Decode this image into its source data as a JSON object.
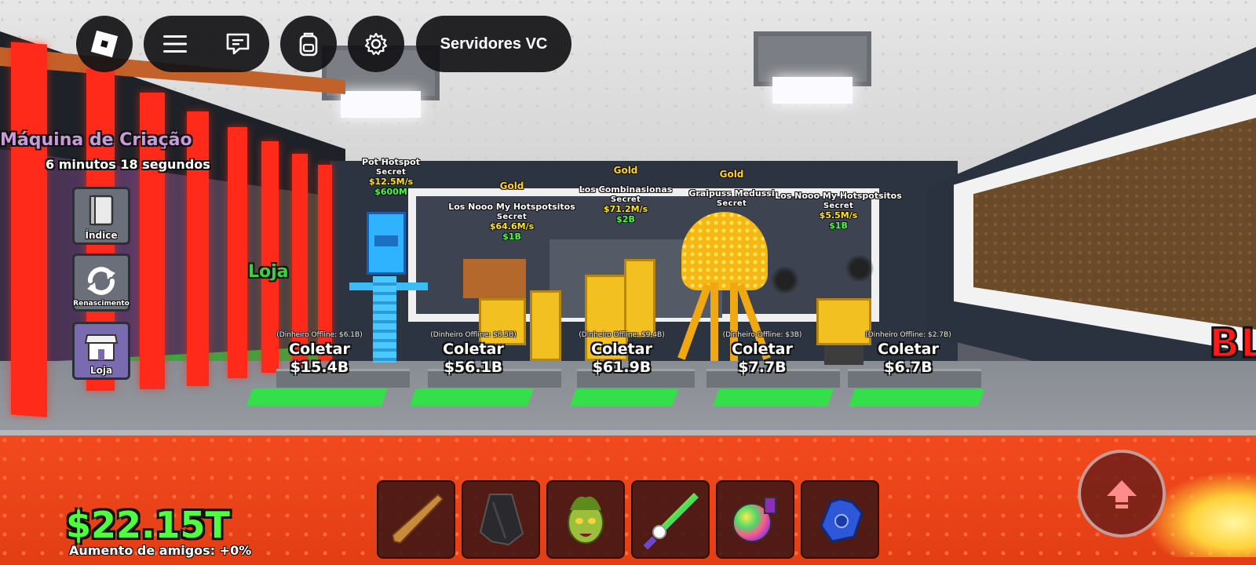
{
  "top_bar": {
    "roblox_menu_icon": "roblox-logo-icon",
    "hamburger_icon": "hamburger-menu-icon",
    "chat_icon": "chat-icon",
    "backpack_icon": "backpack-icon",
    "settings_icon": "gear-icon",
    "servers_label": "Servidores VC"
  },
  "world": {
    "machine_title": "Máquina de Criação",
    "machine_timer": "6 minutos 18 segundos",
    "shop_sign": "Loja",
    "edge_text": "BL"
  },
  "side_buttons": {
    "index_label": "Índice",
    "rebirth_label": "Renascimento",
    "shop_label": "Loja"
  },
  "brainrots": [
    {
      "mutation": "",
      "name": "Pot Hotspot",
      "rarity": "Secret",
      "rate": "$12.5M/s",
      "price": "$600M"
    },
    {
      "mutation": "Gold",
      "name": "Los Nooo My Hotspotsitos",
      "rarity": "Secret",
      "rate": "$64.6M/s",
      "price": "$1B"
    },
    {
      "mutation": "Gold",
      "name": "Los Combinasionas",
      "rarity": "Secret",
      "rate": "$71.2M/s",
      "price": "$2B"
    },
    {
      "mutation": "Gold",
      "name": "Graipuss Medussi",
      "rarity": "Secret",
      "rate": "",
      "price": ""
    },
    {
      "mutation": "",
      "name": "Los Nooo My Hotspotsitos",
      "rarity": "Secret",
      "rate": "$5.5M/s",
      "price": "$1B"
    }
  ],
  "collectors": [
    {
      "offline": "(Dinheiro Offline: $6.1B)",
      "button": "Coletar",
      "amount": "$15.4B"
    },
    {
      "offline": "(Dinheiro Offline: $8.5B)",
      "button": "Coletar",
      "amount": "$56.1B"
    },
    {
      "offline": "(Dinheiro Offline: $9.4B)",
      "button": "Coletar",
      "amount": "$61.9B"
    },
    {
      "offline": "(Dinheiro Offline: $3B)",
      "button": "Coletar",
      "amount": "$7.7B"
    },
    {
      "offline": "(Dinheiro Offline: $2.7B)",
      "button": "Coletar",
      "amount": "$6.7B"
    }
  ],
  "stats": {
    "money": "$22.15T",
    "friend_boost": "Aumento de amigos: +0%"
  },
  "hotbar": [
    {
      "icon": "baseball-bat-icon"
    },
    {
      "icon": "dark-cloak-icon"
    },
    {
      "icon": "medusa-head-icon"
    },
    {
      "icon": "unicorn-sword-icon"
    },
    {
      "icon": "disco-ball-icon"
    },
    {
      "icon": "power-glove-icon"
    }
  ],
  "jump": {
    "icon": "jump-arrow-icon"
  },
  "colors": {
    "money_green": "#4dff3e",
    "collector_pad": "#33e04a",
    "gold_mutation": "#ffd21f",
    "rate_yellow": "#ffe21a"
  }
}
